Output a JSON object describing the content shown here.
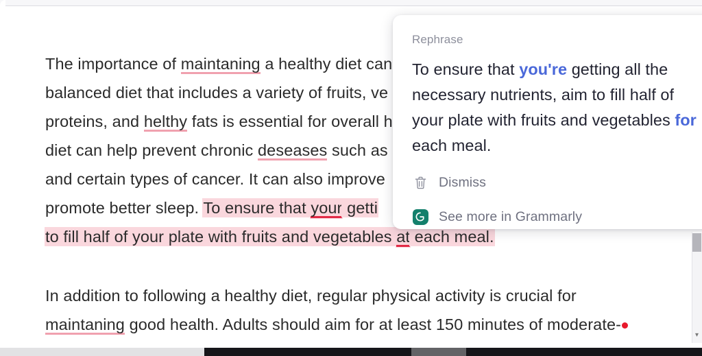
{
  "document": {
    "paragraph1": {
      "segments": [
        {
          "text": "The importance of ",
          "style": "normal"
        },
        {
          "text": "maintaning",
          "style": "misspell"
        },
        {
          "text": " a healthy diet can",
          "style": "normal"
        },
        {
          "text": "\nbalanced diet that includes a variety of fruits, ve",
          "style": "normal"
        },
        {
          "text": "\nproteins, and ",
          "style": "normal"
        },
        {
          "text": "helthy",
          "style": "misspell"
        },
        {
          "text": " fats is essential for overall h",
          "style": "normal"
        },
        {
          "text": "\ndiet can help prevent chronic ",
          "style": "normal"
        },
        {
          "text": "deseases",
          "style": "misspell"
        },
        {
          "text": " such as",
          "style": "normal"
        },
        {
          "text": "\nand certain types of cancer. It can also improve",
          "style": "normal"
        },
        {
          "text": "\npromote better sleep. ",
          "style": "normal"
        },
        {
          "text": "To ensure that ",
          "style": "highlight"
        },
        {
          "text": "your",
          "style": "highlight-fix"
        },
        {
          "text": " getti",
          "style": "highlight"
        },
        {
          "text": "\nto fill half of your plate with fruits and vegetables ",
          "style": "highlight"
        },
        {
          "text": "at",
          "style": "highlight-fix"
        },
        {
          "text": " each meal.",
          "style": "highlight"
        }
      ],
      "line1_a": "The importance of ",
      "line1_misspell": "maintaning",
      "line1_b": " a healthy diet can",
      "line2": "balanced diet that includes a variety of fruits, ve",
      "line3_a": "proteins, and ",
      "line3_misspell": "helthy",
      "line3_b": " fats is essential for overall h",
      "line4_a": "diet can help prevent chronic ",
      "line4_misspell": "deseases",
      "line4_b": " such as",
      "line5": "and certain types of cancer. It can also improve",
      "line6_a": "promote better sleep. ",
      "line6_hl_a": "To ensure that ",
      "line6_hl_fix": "your",
      "line6_hl_b": " getti",
      "line7_hl_a": "to fill half of your plate with fruits and vegetables ",
      "line7_hl_fix": "at",
      "line7_hl_b": " each meal."
    },
    "paragraph2": {
      "line1": "In addition to following a healthy diet, regular physical activity is crucial for",
      "line2_misspell": "maintaning",
      "line2_rest": " good health. Adults should aim for at least 150 minutes of moderate-"
    }
  },
  "suggestion_card": {
    "kicker": "Rephrase",
    "text_a": "To ensure that ",
    "text_bold1": "you're",
    "text_b": " getting all the necessary nutrients, aim to fill half of your plate with fruits and vegetables ",
    "text_bold2": "for",
    "text_c": " each meal.",
    "dismiss_label": "Dismiss",
    "see_more_label": "See more in Grammarly",
    "dismiss_icon": "trash-icon",
    "brand_icon": "grammarly-logo-icon"
  },
  "colors": {
    "suggestion_accent": "#4a68d9",
    "highlight_pink": "#fad7dd",
    "misspell_underline": "#f0a1af",
    "fix_underline": "#e22a46",
    "grammarly_green": "#14806c",
    "cursor_dot": "#e8192c"
  }
}
